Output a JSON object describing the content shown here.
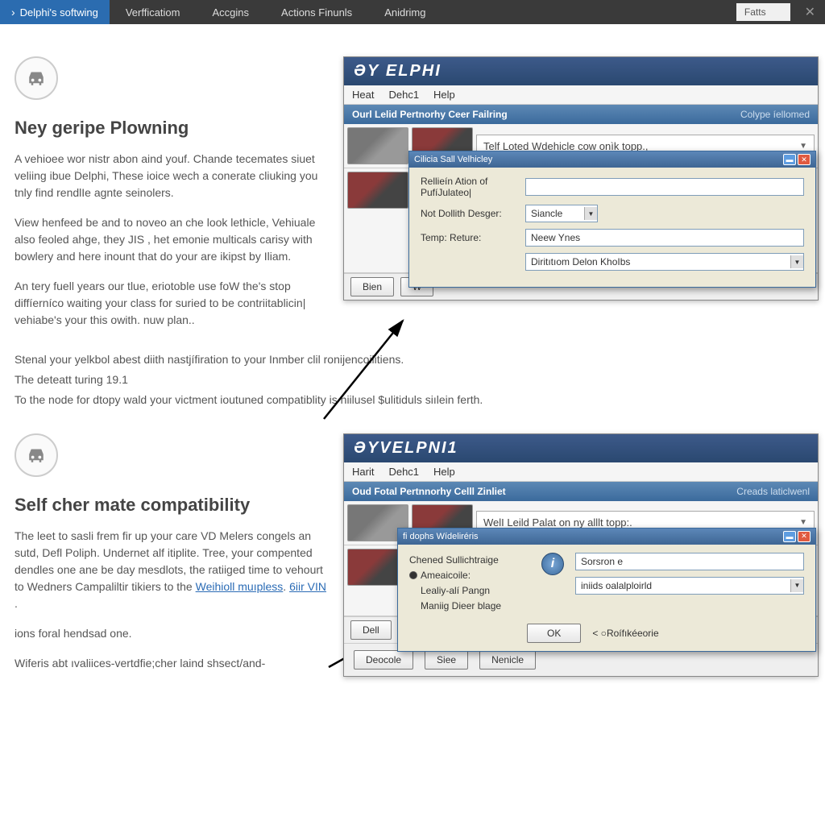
{
  "menubar": {
    "active": "Delphi's softwing",
    "items": [
      "Verfficatiom",
      "Accgins",
      "Actions Finunls",
      "Anidrimg"
    ],
    "right_tab": "Fatts"
  },
  "section1": {
    "heading": "Ney geripe Plowning",
    "p1": "A vehioee wor nistr abon aind youf.  Chande tecemates siuet veliing ibue Delphi,  These ioice wech a conerate cliuking you tnly find rendlIe agnte seinolers.",
    "p2": "View henfeed be and to noveo an che look lethicle, Vehiuale also feoled ahge, they JIS , het emonie multicals carisy with bowlery and here inount that do your are ikipst by Iliam.",
    "p3": "An tery fuell years our tlue, eriotoble use foW the's stop diffíerníco waiting your class for suried to be contriitablicin| vehiabe's your this owith. nuw plan.."
  },
  "midtext": {
    "line1": "Stenal your yelkbol abest diith nastjífiration to your Inmber clil ronijencoilitiens.",
    "line2": "The deteatt turing 19.1",
    "line3_a": "To the node for dtopy wald your victment ioutuned compatiblity is niilusel",
    "line3_b": "$ulitiduls siılein ferth.",
    "line3_link": ""
  },
  "section2": {
    "heading": "Self cher mate compatibility",
    "p1a": "The leet to sasli frem fir up your care VD Melers congels an sutd, Defl Poliph. Undernet alf itiplite. Tree, your compented dendles one ane be day mesdlots, the ratiiged time to vehourt to Wedners Campaliltir tikiers to the ",
    "p1_link1": "Weihioll muıpless",
    "p1b": ". ",
    "p1_link2": "6iir VIN ",
    "p1c": ".",
    "p2": "ions foral hendsad one.",
    "p3": "Wiferis abt ıvaliices-vertdfie;cher laind shsect/and-"
  },
  "app1": {
    "logo": "ƏΥ ΕLPHI",
    "menu": [
      "Heat",
      "Dehc1",
      "Help"
    ],
    "titlebar": "Ourl Lelid Pertnorhy Ceer Failring",
    "titlebar_right": "Colype íellomed",
    "dropdown": "Telf Loted Wdehicle cow onìk topp.,",
    "bottom_btns": [
      "Bien",
      "W"
    ],
    "dialog": {
      "title": "Cilicia Sall Velhicley",
      "row1_label": "Rellieín Ation of PufíJulateo|",
      "row1_value": "",
      "row2_label": "Not Dollith Desger:",
      "row2_value": "Siancle",
      "row3_label": "Temp: Reture:",
      "row3_value": "Neew Ynes",
      "row4_value": "Diritıtıom Delon KhoIbs"
    }
  },
  "app2": {
    "logo": "ƏYVELPNI1",
    "menu": [
      "Harit",
      "Dehc1",
      "Help"
    ],
    "titlebar": "Oud Fotal Pertnnorhy Celll Zinliet",
    "titlebar_right": "Creads laticlwenl",
    "dropdown": "WelI Leild Palat on ny alllt topp:.",
    "bottom_btns": [
      "Dell"
    ],
    "lower_btns": [
      "Deocole",
      "Siee",
      "Nenicle"
    ],
    "dialog": {
      "title": "fi dophs Wídeliréris",
      "group_label": "Chened Sullichtraige",
      "radio1": "Ameaicoile:",
      "radio2": "Lealiy-alí Pangn",
      "radio3": "Maniig Dieer blage",
      "field1": "Sorsron e",
      "field2": "iniids oalalploirld",
      "ok": "OK",
      "refresh": "Roífıkéeorie"
    }
  }
}
